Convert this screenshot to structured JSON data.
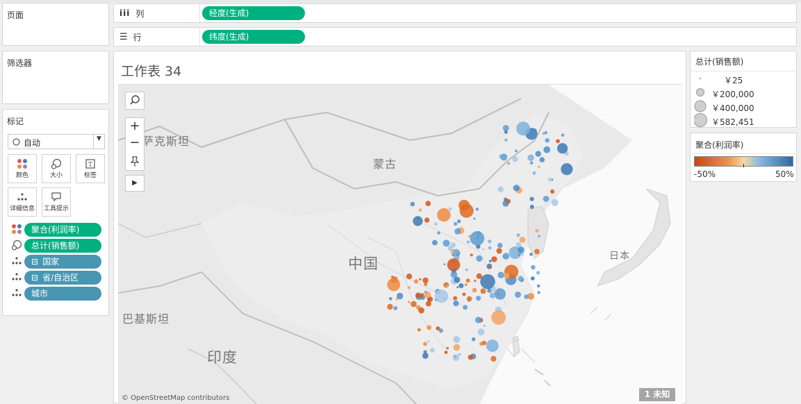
{
  "pages_panel": {
    "title": "页面"
  },
  "filters_panel": {
    "title": "筛选器"
  },
  "marks_panel": {
    "title": "标记",
    "mark_type": "自动",
    "buttons": [
      {
        "label": "颜色",
        "icon": "color-icon"
      },
      {
        "label": "大小",
        "icon": "size-icon"
      },
      {
        "label": "标签",
        "icon": "label-icon"
      },
      {
        "label": "详细信息",
        "icon": "detail-icon"
      },
      {
        "label": "工具提示",
        "icon": "tooltip-icon"
      }
    ],
    "fields": [
      {
        "label": "聚合(利润率)",
        "icon": "color-icon",
        "color": "green"
      },
      {
        "label": "总计(销售额)",
        "icon": "size-icon",
        "color": "green"
      },
      {
        "label": "国家",
        "icon": "detail-icon",
        "color": "blue",
        "prefix": "⊟"
      },
      {
        "label": "省/自治区",
        "icon": "detail-icon",
        "color": "blue",
        "prefix": "⊟"
      },
      {
        "label": "城市",
        "icon": "detail-icon",
        "color": "blue"
      }
    ]
  },
  "shelves": {
    "columns": {
      "label": "列",
      "pill": "经度(生成)"
    },
    "rows": {
      "label": "行",
      "pill": "纬度(生成)"
    }
  },
  "sheet": {
    "title": "工作表 34",
    "map_labels": [
      "哈萨克斯坦",
      "蒙古",
      "中国",
      "巴基斯坦",
      "印度",
      "日本"
    ],
    "attribution": "© OpenStreetMap contributors",
    "unknown_badge": "1 未知"
  },
  "size_legend": {
    "title": "总计(销售额)",
    "items": [
      "￥25",
      "￥200,000",
      "￥400,000",
      "￥582,451"
    ]
  },
  "color_legend": {
    "title": "聚合(利润率)",
    "min_label": "-50%",
    "max_label": "50%",
    "colors": {
      "negative": "#c4471a",
      "mid": "#f5d9a8",
      "positive": "#2d6a9f"
    }
  },
  "colors": {
    "pill_green": "#00b180",
    "pill_blue": "#4996b2"
  }
}
